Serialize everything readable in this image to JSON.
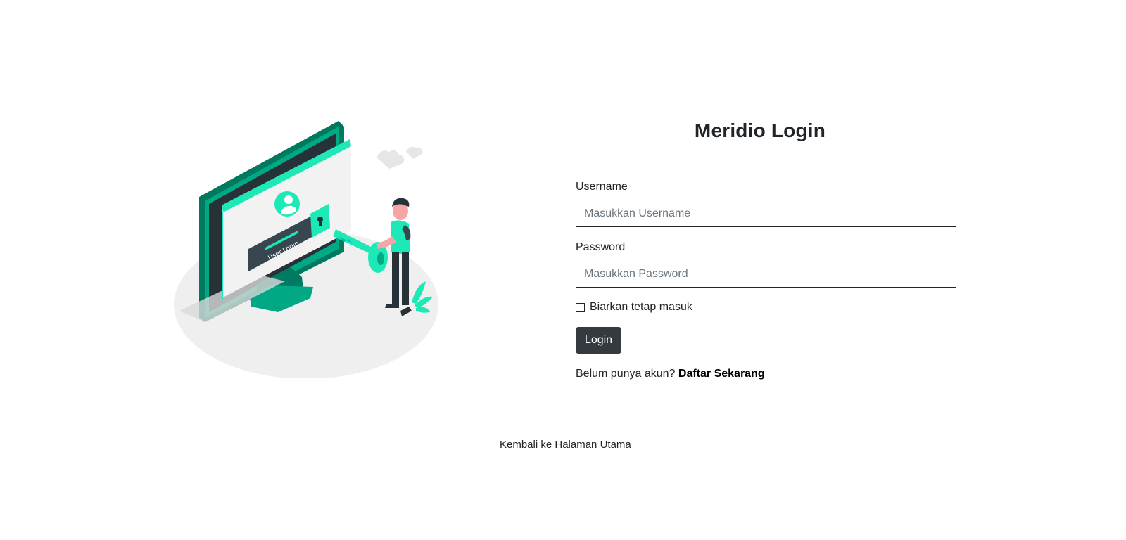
{
  "illustration": {
    "screen_label": "User Login",
    "colors": {
      "accent": "#1de9b6",
      "teal": "#00a884",
      "dark": "#263238",
      "ground": "#efefef"
    }
  },
  "form": {
    "title": "Meridio Login",
    "username": {
      "label": "Username",
      "placeholder": "Masukkan Username",
      "value": ""
    },
    "password": {
      "label": "Password",
      "placeholder": "Masukkan Password",
      "value": ""
    },
    "remember_label": "Biarkan tetap masuk",
    "remember_checked": false,
    "login_button": "Login",
    "signup_prompt": "Belum punya akun?",
    "signup_link": "Daftar Sekarang"
  },
  "footer": {
    "back_link": "Kembali ke Halaman Utama"
  },
  "colors": {
    "button_bg": "#343a40",
    "text": "#212529",
    "placeholder": "#6c757d"
  }
}
